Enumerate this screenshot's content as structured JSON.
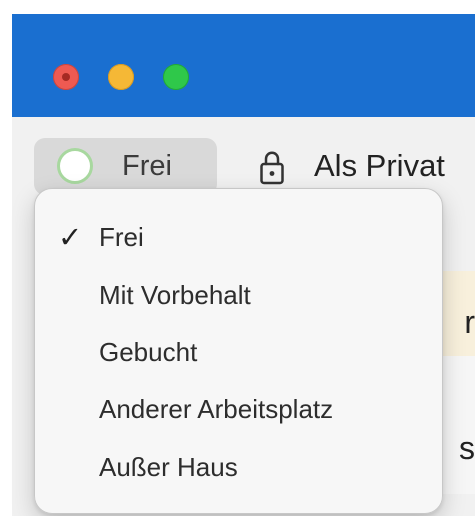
{
  "window": {
    "controls": [
      {
        "name": "close",
        "color": "#ee5a52"
      },
      {
        "name": "minimize",
        "color": "#f5b836"
      },
      {
        "name": "zoom",
        "color": "#2fc84a"
      }
    ]
  },
  "toolbar": {
    "status_button_label": "Frei",
    "private_label": "Als Privat"
  },
  "status_menu": {
    "items": [
      {
        "label": "Frei",
        "checked": true,
        "check_mark": "✓"
      },
      {
        "label": "Mit Vorbehalt",
        "checked": false
      },
      {
        "label": "Gebucht",
        "checked": false
      },
      {
        "label": "Anderer Arbeitsplatz",
        "checked": false
      },
      {
        "label": "Außer Haus",
        "checked": false
      }
    ]
  },
  "background_glimpses": {
    "top_char": "r",
    "bottom_char": "s"
  },
  "colors": {
    "titlebar": "#1a6fd0",
    "status_button": "#d9d9d9",
    "menu_background": "#f7f7f7",
    "free_status_ring": "#a8d89f"
  }
}
